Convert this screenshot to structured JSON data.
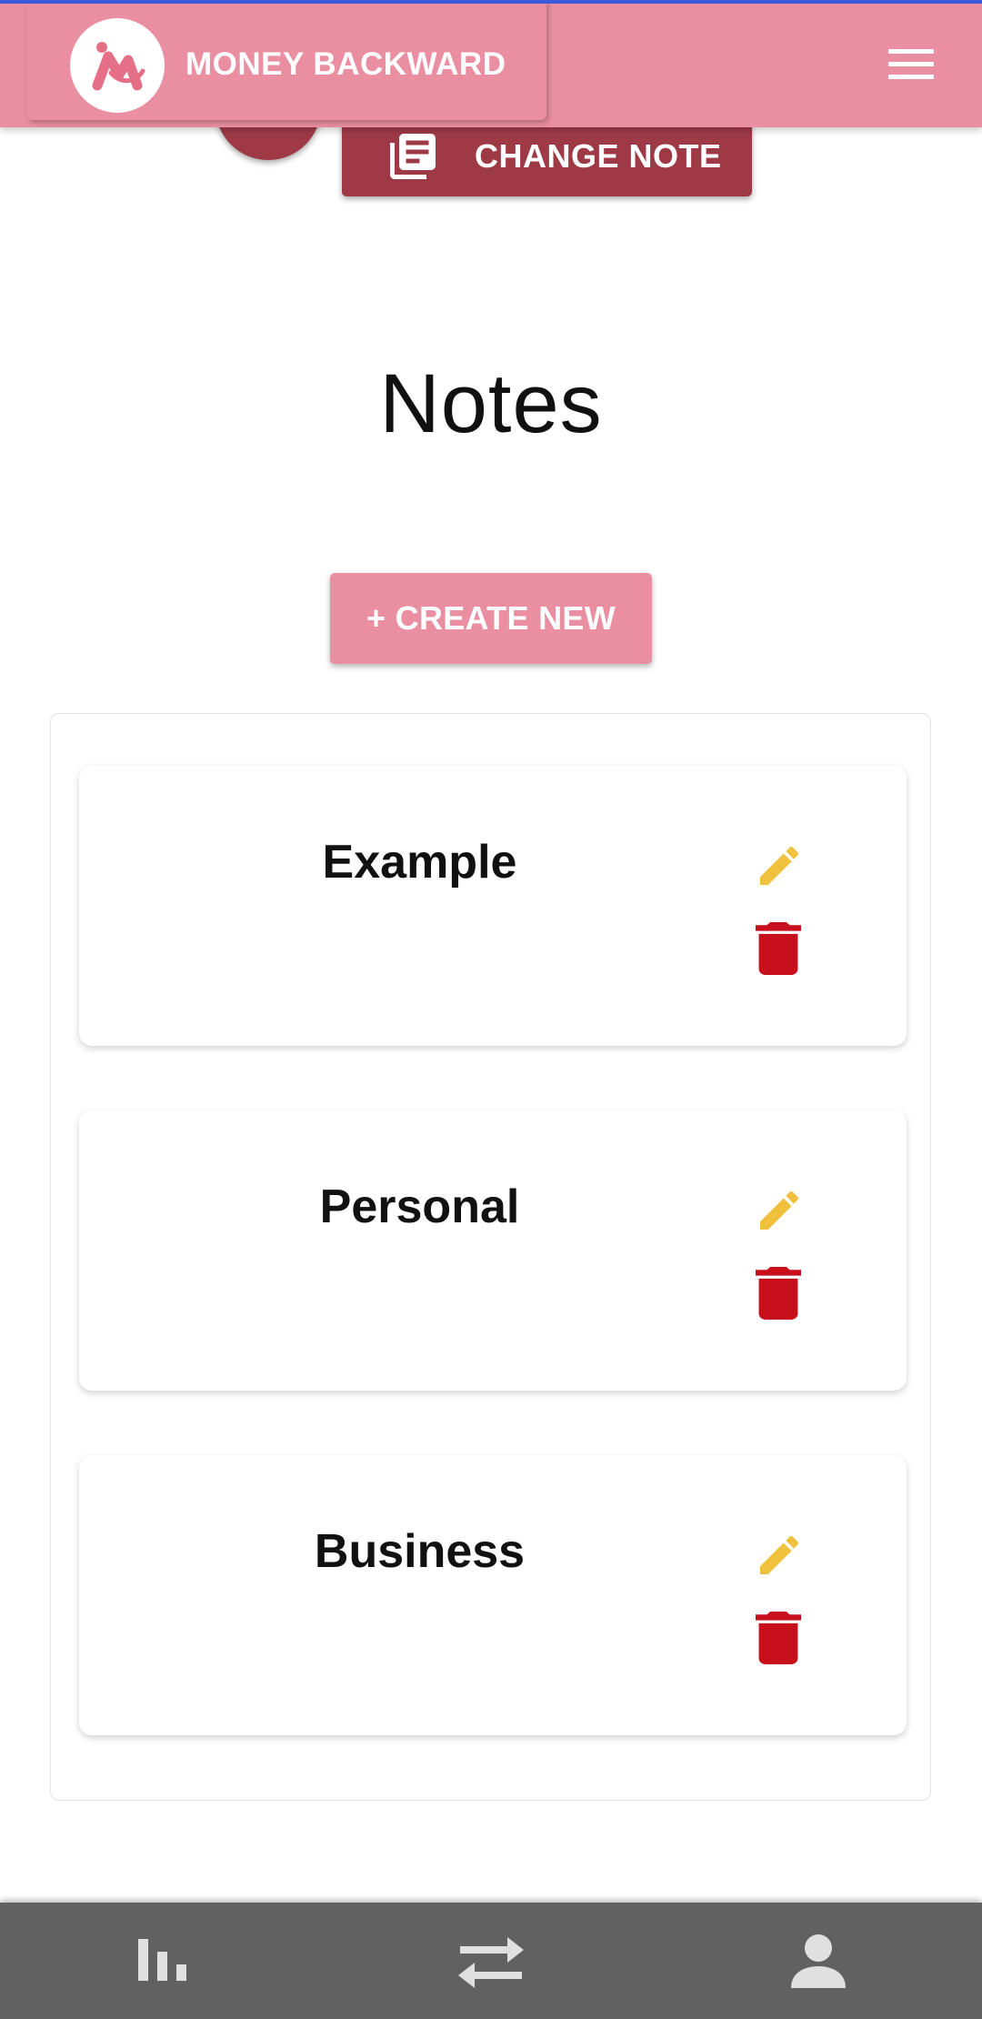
{
  "app": {
    "title": "MONEY BACKWARD"
  },
  "toolbar": {
    "change_note_label": "CHANGE NOTE"
  },
  "main": {
    "title": "Notes",
    "create_label": "+ CREATE NEW",
    "notes": [
      {
        "name": "Example"
      },
      {
        "name": "Personal"
      },
      {
        "name": "Business"
      }
    ]
  },
  "bottom_nav": {
    "items": [
      {
        "icon": "bar-chart-icon"
      },
      {
        "icon": "swap-arrows-icon"
      },
      {
        "icon": "person-icon"
      }
    ]
  },
  "colors": {
    "brand_pink": "#ea8fa1",
    "dark_red": "#9e3a46",
    "edit_yellow": "#efc13c",
    "delete_red": "#c8101c",
    "nav_gray": "#616161"
  }
}
